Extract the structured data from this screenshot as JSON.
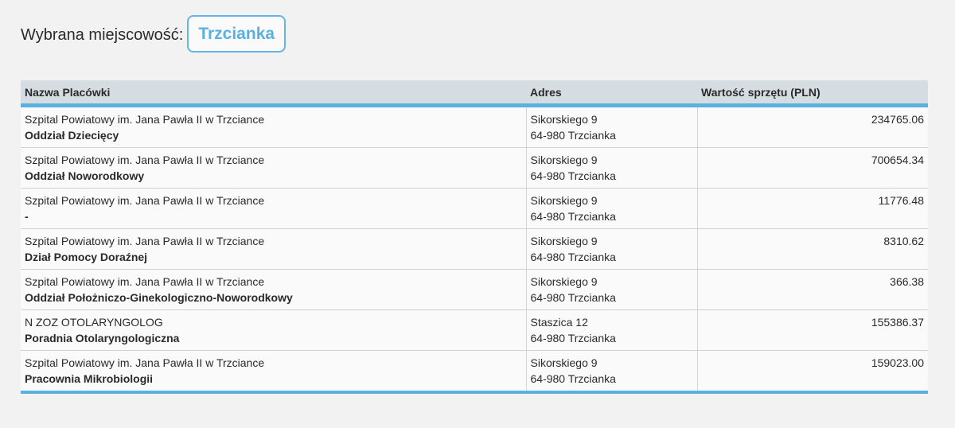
{
  "header": {
    "label": "Wybrana miejscowość:",
    "town": "Trzcianka"
  },
  "table": {
    "columns": [
      "Nazwa Placówki",
      "Adres",
      "Wartość sprzętu (PLN)"
    ],
    "rows": [
      {
        "facility": "Szpital Powiatowy im. Jana Pawła II w Trzciance",
        "unit": "Oddział Dziecięcy",
        "street": "Sikorskiego 9",
        "city": "64-980 Trzcianka",
        "value": "234765.06"
      },
      {
        "facility": "Szpital Powiatowy im. Jana Pawła II w Trzciance",
        "unit": "Oddział Noworodkowy",
        "street": "Sikorskiego 9",
        "city": "64-980 Trzcianka",
        "value": "700654.34"
      },
      {
        "facility": "Szpital Powiatowy im. Jana Pawła II w Trzciance",
        "unit": "-",
        "street": "Sikorskiego 9",
        "city": "64-980 Trzcianka",
        "value": "11776.48"
      },
      {
        "facility": "Szpital Powiatowy im. Jana Pawła II w Trzciance",
        "unit": "Dział Pomocy Doraźnej",
        "street": "Sikorskiego 9",
        "city": "64-980 Trzcianka",
        "value": "8310.62"
      },
      {
        "facility": "Szpital Powiatowy im. Jana Pawła II w Trzciance",
        "unit": "Oddział Położniczo-Ginekologiczno-Noworodkowy",
        "street": "Sikorskiego 9",
        "city": "64-980 Trzcianka",
        "value": "366.38"
      },
      {
        "facility": "N ZOZ OTOLARYNGOLOG",
        "unit": "Poradnia Otolaryngologiczna",
        "street": "Staszica 12",
        "city": "64-980 Trzcianka",
        "value": "155386.37"
      },
      {
        "facility": "Szpital Powiatowy im. Jana Pawła II w Trzciance",
        "unit": "Pracownia Mikrobiologii",
        "street": "Sikorskiego 9",
        "city": "64-980 Trzcianka",
        "value": "159023.00"
      }
    ]
  },
  "colors": {
    "accent": "#5ab1e0",
    "header_bg": "#d6dde2",
    "page_bg": "#f2f2f2"
  }
}
